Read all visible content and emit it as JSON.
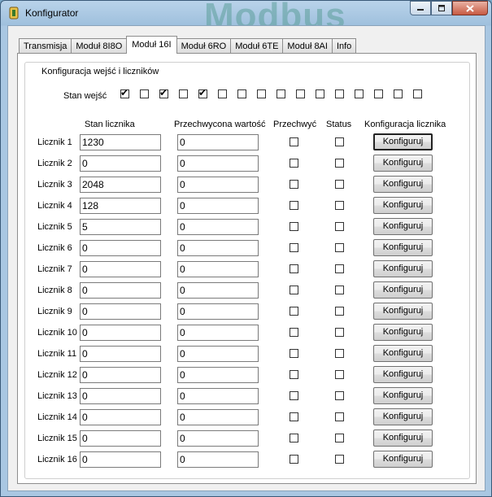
{
  "window": {
    "title": "Konfigurator",
    "background_text": "Modbus"
  },
  "tabs": [
    {
      "label": "Transmisja",
      "active": false
    },
    {
      "label": "Moduł 8I8O",
      "active": false
    },
    {
      "label": "Moduł 16I",
      "active": true
    },
    {
      "label": "Moduł 6RO",
      "active": false
    },
    {
      "label": "Moduł 6TE",
      "active": false
    },
    {
      "label": "Moduł 8AI",
      "active": false
    },
    {
      "label": "Info",
      "active": false
    }
  ],
  "group": {
    "title": "Konfiguracja wejść i liczników",
    "inputs_label": "Stan wejść",
    "inputs_state": [
      true,
      false,
      true,
      false,
      true,
      false,
      false,
      false,
      false,
      false,
      false,
      false,
      false,
      false,
      false,
      false
    ]
  },
  "columns": {
    "counter_state": "Stan licznika",
    "captured_value": "Przechwycona wartość",
    "capture": "Przechwyć",
    "status": "Status",
    "config": "Konfiguracja licznika"
  },
  "counters": [
    {
      "label": "Licznik 1",
      "state": "1230",
      "captured": "0",
      "capture": false,
      "status": false,
      "button": "Konfiguruj"
    },
    {
      "label": "Licznik 2",
      "state": "0",
      "captured": "0",
      "capture": false,
      "status": false,
      "button": "Konfiguruj"
    },
    {
      "label": "Licznik 3",
      "state": "2048",
      "captured": "0",
      "capture": false,
      "status": false,
      "button": "Konfiguruj"
    },
    {
      "label": "Licznik 4",
      "state": "128",
      "captured": "0",
      "capture": false,
      "status": false,
      "button": "Konfiguruj"
    },
    {
      "label": "Licznik 5",
      "state": "5",
      "captured": "0",
      "capture": false,
      "status": false,
      "button": "Konfiguruj"
    },
    {
      "label": "Licznik 6",
      "state": "0",
      "captured": "0",
      "capture": false,
      "status": false,
      "button": "Konfiguruj"
    },
    {
      "label": "Licznik 7",
      "state": "0",
      "captured": "0",
      "capture": false,
      "status": false,
      "button": "Konfiguruj"
    },
    {
      "label": "Licznik 8",
      "state": "0",
      "captured": "0",
      "capture": false,
      "status": false,
      "button": "Konfiguruj"
    },
    {
      "label": "Licznik 9",
      "state": "0",
      "captured": "0",
      "capture": false,
      "status": false,
      "button": "Konfiguruj"
    },
    {
      "label": "Licznik 10",
      "state": "0",
      "captured": "0",
      "capture": false,
      "status": false,
      "button": "Konfiguruj"
    },
    {
      "label": "Licznik 11",
      "state": "0",
      "captured": "0",
      "capture": false,
      "status": false,
      "button": "Konfiguruj"
    },
    {
      "label": "Licznik 12",
      "state": "0",
      "captured": "0",
      "capture": false,
      "status": false,
      "button": "Konfiguruj"
    },
    {
      "label": "Licznik 13",
      "state": "0",
      "captured": "0",
      "capture": false,
      "status": false,
      "button": "Konfiguruj"
    },
    {
      "label": "Licznik 14",
      "state": "0",
      "captured": "0",
      "capture": false,
      "status": false,
      "button": "Konfiguruj"
    },
    {
      "label": "Licznik 15",
      "state": "0",
      "captured": "0",
      "capture": false,
      "status": false,
      "button": "Konfiguruj"
    },
    {
      "label": "Licznik 16",
      "state": "0",
      "captured": "0",
      "capture": false,
      "status": false,
      "button": "Konfiguruj"
    }
  ]
}
